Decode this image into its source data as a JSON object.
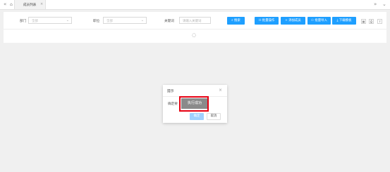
{
  "tabbar": {
    "home_icon": "home-icon",
    "tab_label": "成员列表",
    "close_glyph": "×",
    "left_glyph": "«",
    "right_glyph": "»",
    "down_glyph": "⌄"
  },
  "filters": {
    "department_label": "部门",
    "department_value": "全部",
    "position_label": "职位",
    "position_value": "全部",
    "keyword_label": "关键词",
    "keyword_placeholder": "请输入关键词"
  },
  "toolbar": {
    "search": "搜索",
    "batch_operate": "批量操作",
    "add_member": "添加成员",
    "batch_import": "批量导入",
    "download_template": "下载模板"
  },
  "dialog": {
    "title": "提示",
    "message": "确定要",
    "toast": "执行成功",
    "ok": "确定",
    "cancel": "取消"
  },
  "colors": {
    "primary": "#1e9fff",
    "highlight": "#e60012"
  }
}
